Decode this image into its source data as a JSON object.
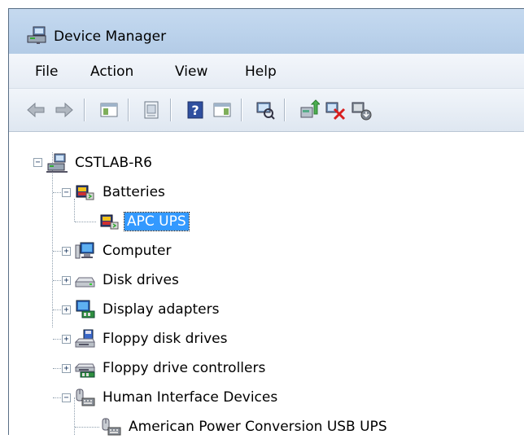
{
  "window": {
    "title": "Device Manager"
  },
  "menu": [
    "File",
    "Action",
    "View",
    "Help"
  ],
  "toolbar": {
    "buttons": [
      "back-icon",
      "forward-icon",
      "properties-icon",
      "show-hide-console-tree-icon",
      "help-icon",
      "action-pane-icon",
      "scan-hardware-icon",
      "update-driver-icon",
      "uninstall-icon",
      "disable-icon"
    ]
  },
  "tree": {
    "root": "CSTLAB-R6",
    "batteries": "Batteries",
    "apc_ups": "APC UPS",
    "computer": "Computer",
    "disk_drives": "Disk drives",
    "display_adapters": "Display adapters",
    "floppy_disk_drives": "Floppy disk drives",
    "floppy_drive_controllers": "Floppy drive controllers",
    "hid": "Human Interface Devices",
    "hid_child": "American Power Conversion USB UPS"
  },
  "colors": {
    "selection": "#3399ff",
    "titlebar": "#bcd3ec",
    "window_border": "#5a6f86"
  }
}
